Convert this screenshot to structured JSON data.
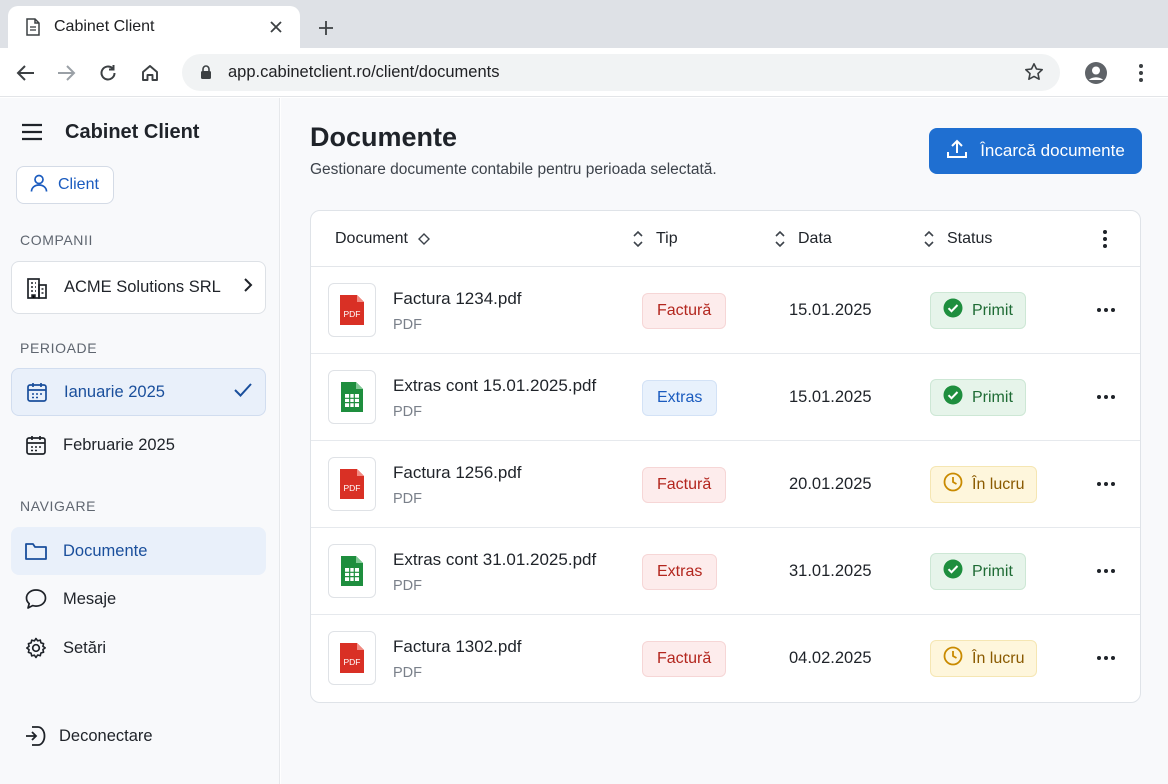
{
  "browser": {
    "tab_title": "Cabinet Client",
    "url": "app.cabinetclient.ro/client/documents"
  },
  "sidebar": {
    "brand": "Cabinet Client",
    "client_chip": "Client",
    "companies_label": "COMPANII",
    "company": "ACME Solutions SRL",
    "periods_label": "PERIOADE",
    "periods": [
      {
        "label": "Ianuarie 2025",
        "selected": true
      },
      {
        "label": "Februarie 2025",
        "selected": false
      }
    ],
    "nav_label": "NAVIGARE",
    "nav": [
      {
        "label": "Documente",
        "icon": "folder-icon",
        "active": true
      },
      {
        "label": "Mesaje",
        "icon": "chat-icon",
        "active": false
      },
      {
        "label": "Setări",
        "icon": "gear-icon",
        "active": false
      }
    ],
    "logout": "Deconectare"
  },
  "main": {
    "title": "Documente",
    "subtitle": "Gestionare documente contabile pentru perioada selectată.",
    "upload_button": "Încarcă documente"
  },
  "table": {
    "columns": [
      "Document",
      "Tip",
      "Data",
      "Status"
    ],
    "rows": [
      {
        "name": "Factura 1234.pdf",
        "filetype": "PDF",
        "icon": "pdf-icon",
        "type": "Factură",
        "date": "15.01.2025",
        "status": "Primit"
      },
      {
        "name": "Extras cont 15.01.2025.pdf",
        "filetype": "PDF",
        "icon": "spreadsheet-icon",
        "type": "Extras",
        "date": "15.01.2025",
        "status": "Primit"
      },
      {
        "name": "Factura 1256.pdf",
        "filetype": "PDF",
        "icon": "pdf-icon",
        "type": "Factură",
        "date": "20.01.2025",
        "status": "În lucru"
      },
      {
        "name": "Extras cont 31.01.2025.pdf",
        "filetype": "PDF",
        "icon": "spreadsheet-icon",
        "type": "Extras",
        "date": "31.01.2025",
        "status": "Primit"
      },
      {
        "name": "Factura 1302.pdf",
        "filetype": "PDF",
        "icon": "pdf-icon",
        "type": "Factură",
        "date": "04.02.2025",
        "status": "În lucru"
      }
    ]
  },
  "colors": {
    "accent": "#1f6fd1",
    "success": "#1e8e3e",
    "warning": "#c98a00",
    "danger": "#d93025"
  }
}
